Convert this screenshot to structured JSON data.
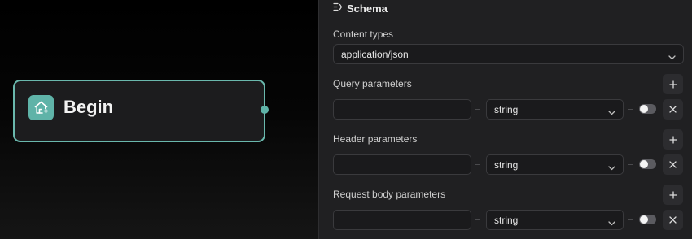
{
  "canvas": {
    "node": {
      "title": "Begin",
      "icon": "home-icon",
      "accent": "#5fb3a8"
    }
  },
  "panel": {
    "header": {
      "icon": "schema-icon",
      "title": "Schema"
    },
    "content_types": {
      "label": "Content types",
      "value": "application/json"
    },
    "sections": [
      {
        "label": "Query parameters",
        "name_value": "",
        "type_value": "string",
        "enabled": false
      },
      {
        "label": "Header parameters",
        "name_value": "",
        "type_value": "string",
        "enabled": false
      },
      {
        "label": "Request body parameters",
        "name_value": "",
        "type_value": "string",
        "enabled": false
      }
    ]
  }
}
